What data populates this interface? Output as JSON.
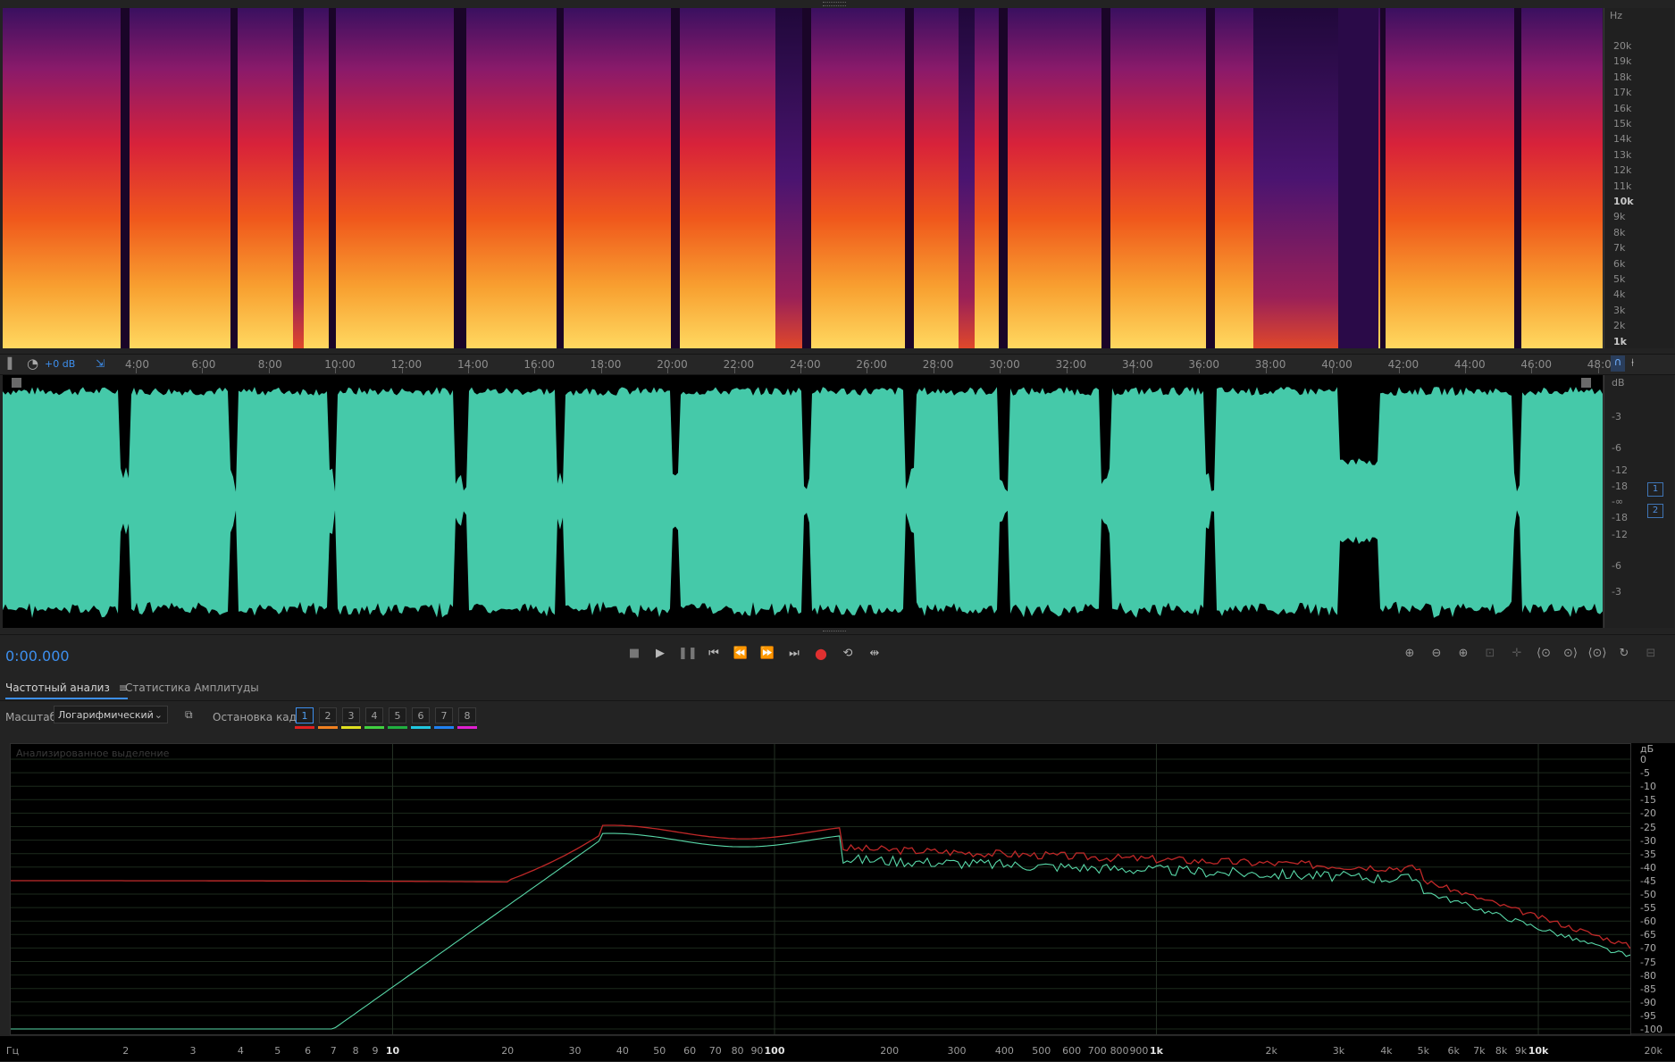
{
  "spectrogram": {
    "unit": "Hz",
    "ticks": [
      "20k",
      "19k",
      "18k",
      "17k",
      "16k",
      "15k",
      "14k",
      "13k",
      "12k",
      "11k",
      "10k",
      "9k",
      "8k",
      "7k",
      "6k",
      "5k",
      "4k",
      "3k",
      "2k",
      "1k"
    ],
    "bold_ticks": [
      "10k",
      "1k"
    ]
  },
  "timeline": {
    "gain": "+0 dB",
    "labels": [
      "4:00",
      "6:00",
      "8:00",
      "10:00",
      "12:00",
      "14:00",
      "16:00",
      "18:00",
      "20:00",
      "22:00",
      "24:00",
      "26:00",
      "28:00",
      "30:00",
      "32:00",
      "34:00",
      "36:00",
      "38:00",
      "40:00",
      "42:00",
      "44:00",
      "46:00",
      "48:0"
    ]
  },
  "waveform": {
    "unit": "dB",
    "ticks_top": [
      "-3",
      "-6",
      "-12",
      "-18"
    ],
    "center": "-∞",
    "ticks_bottom": [
      "-18",
      "-12",
      "-6",
      "-3"
    ],
    "channels": [
      "1",
      "2"
    ],
    "color": "#45c9a9"
  },
  "transport": {
    "time": "0:00.000",
    "record_color": "#e03030"
  },
  "panel": {
    "tab_frequency": "Частотный анализ",
    "tab_frequency_menu": "≡",
    "tab_amplitude": "Статистика Амплитуды",
    "scale_label": "Масштаб:",
    "scale_value": "Логарифмический",
    "freeze_label": "Остановка кадра:",
    "frames": [
      "1",
      "2",
      "3",
      "4",
      "5",
      "6",
      "7",
      "8"
    ],
    "frame_colors": [
      "#e02020",
      "#f08020",
      "#e0e020",
      "#40d040",
      "#20b040",
      "#20c8e0",
      "#2080f0",
      "#e020d0"
    ]
  },
  "analysis": {
    "hint": "Анализированное выделение",
    "db_unit": "дБ",
    "db_ticks": [
      "0",
      "-5",
      "-10",
      "-15",
      "-20",
      "-25",
      "-30",
      "-35",
      "-40",
      "-45",
      "-50",
      "-55",
      "-60",
      "-65",
      "-70",
      "-75",
      "-80",
      "-85",
      "-90",
      "-95",
      "-100"
    ],
    "freq_unit": "Гц",
    "freq_ticks": [
      "2",
      "3",
      "4",
      "5",
      "6",
      "7",
      "8",
      "9",
      "10",
      "20",
      "30",
      "40",
      "50",
      "60",
      "70",
      "80",
      "90",
      "100",
      "200",
      "300",
      "400",
      "500",
      "600",
      "700",
      "800",
      "900",
      "1k",
      "2k",
      "3k",
      "4k",
      "5k",
      "6k",
      "7k",
      "8k",
      "9k",
      "10k",
      "20k"
    ],
    "freq_bold": [
      "10",
      "100",
      "1k",
      "10k"
    ],
    "series_colors": {
      "peak": "#c02828",
      "average": "#58d8a8"
    }
  }
}
